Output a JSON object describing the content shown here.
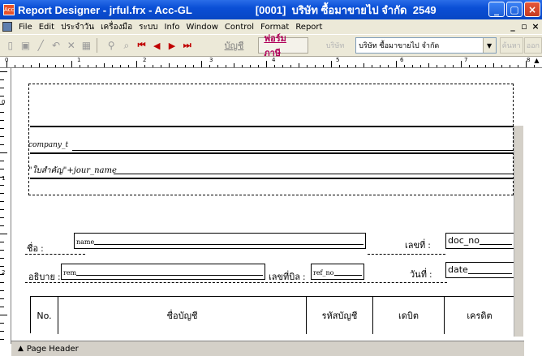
{
  "window": {
    "title": "Report Designer - jrful.frx - Acc-GL",
    "company_tag": "[0001]  บริษัท ซื้อมาขายไป จำกัด  2549",
    "app_icon": "foxpro-app-icon"
  },
  "menu": {
    "items": [
      "File",
      "Edit",
      "ประจำวัน",
      "เครื่องมือ",
      "ระบบ",
      "Info",
      "Window",
      "Control",
      "Format",
      "Report"
    ],
    "mdi_buttons": [
      "_",
      "▫",
      "×"
    ]
  },
  "toolbar": {
    "tab_account": "บัญชี",
    "tab_form": "ฟอร์มภาษี",
    "company_label": "บริษัท",
    "company_select": "บริษัท ซื้อมาขายไป จำกัด",
    "btn_find": "ค้นหา",
    "btn_exit": "ออก"
  },
  "ruler": {
    "marks": [
      "0",
      "1",
      "2",
      "3",
      "4",
      "5",
      "6",
      "7",
      "8"
    ],
    "vmarks": [
      "0",
      "1",
      "2"
    ]
  },
  "report": {
    "company_field": "company_t",
    "journal_field": "\"ใบสำคัญ\"+jour_name",
    "name_label": "ชื่อ :",
    "name_field": "name",
    "docno_label": "เลขที่ :",
    "docno_field": "doc_no",
    "desc_label": "อธิบาย :",
    "desc_field": "rem",
    "refno_label": "เลขที่บิล :",
    "refno_field": "ref_no",
    "date_label": "วันที่ :",
    "date_field": "date",
    "columns": [
      "No.",
      "ชื่อบัญชี",
      "รหัสบัญชี",
      "เดบิต",
      "เครดิต"
    ]
  },
  "band": {
    "label": "Page Header"
  }
}
